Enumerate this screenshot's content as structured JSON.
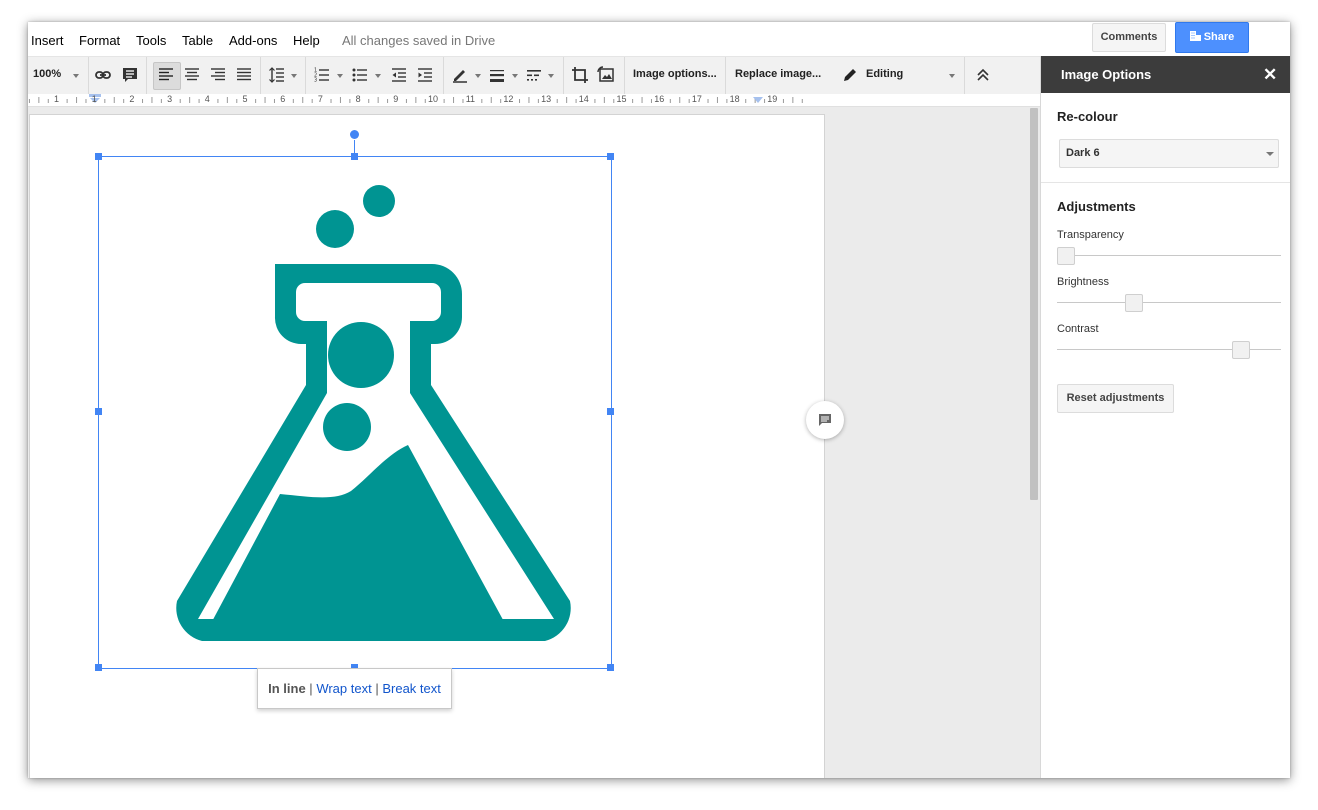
{
  "menubar": {
    "items": [
      "Insert",
      "Format",
      "Tools",
      "Table",
      "Add-ons",
      "Help"
    ],
    "status": "All changes saved in Drive",
    "comments_label": "Comments",
    "share_label": "Share"
  },
  "toolbar": {
    "zoom": "100%",
    "image_options_label": "Image options...",
    "replace_image_label": "Replace image...",
    "mode_label": "Editing"
  },
  "ruler": {
    "numbers": [
      "1",
      "1",
      "2",
      "3",
      "4",
      "5",
      "6",
      "7",
      "8",
      "9",
      "10",
      "11",
      "12",
      "13",
      "14",
      "15",
      "16",
      "17",
      "18",
      "19"
    ]
  },
  "image_wrap": {
    "inline_label": "In line",
    "separator": "|",
    "wrap_label": "Wrap text",
    "break_label": "Break text"
  },
  "panel": {
    "title": "Image Options",
    "recolour_title": "Re-colour",
    "recolour_value": "Dark 6",
    "adjustments_title": "Adjustments",
    "transparency_label": "Transparency",
    "transparency_value": 0,
    "brightness_label": "Brightness",
    "brightness_value": 0.33,
    "contrast_label": "Contrast",
    "contrast_value": 0.85,
    "reset_label": "Reset adjustments"
  },
  "colors": {
    "flask": "#009492",
    "accent": "#4285f4",
    "share": "#4d90fe"
  }
}
